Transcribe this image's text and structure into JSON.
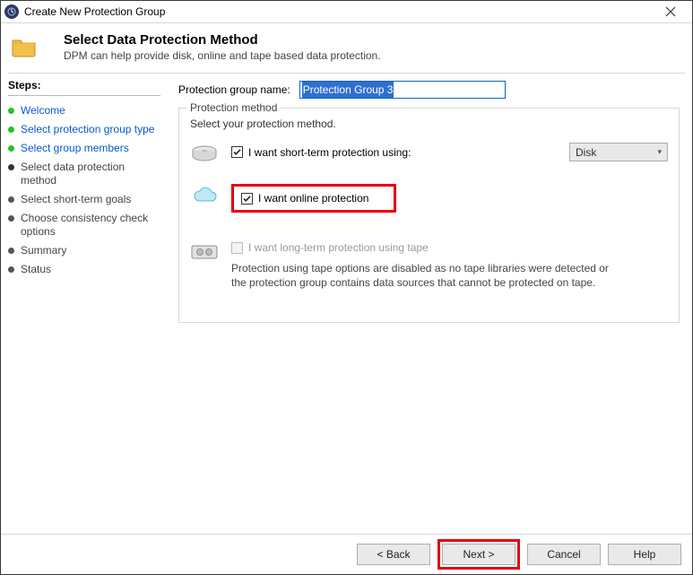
{
  "window": {
    "title": "Create New Protection Group"
  },
  "header": {
    "title": "Select Data Protection Method",
    "subtitle": "DPM can help provide disk, online and tape based data protection."
  },
  "sidebar": {
    "heading": "Steps:",
    "items": [
      {
        "label": "Welcome",
        "state": "done"
      },
      {
        "label": "Select protection group type",
        "state": "done"
      },
      {
        "label": "Select group members",
        "state": "done"
      },
      {
        "label": "Select data protection method",
        "state": "current"
      },
      {
        "label": "Select short-term goals",
        "state": "pending"
      },
      {
        "label": "Choose consistency check options",
        "state": "pending"
      },
      {
        "label": "Summary",
        "state": "pending"
      },
      {
        "label": "Status",
        "state": "pending"
      }
    ]
  },
  "main": {
    "name_label": "Protection group name:",
    "name_value": "Protection Group 3",
    "method_legend": "Protection method",
    "method_instruction": "Select your protection method.",
    "short_term_label": "I want short-term protection using:",
    "short_term_checked": true,
    "short_term_select": "Disk",
    "online_label": "I want online protection",
    "online_checked": true,
    "tape_label": "I want long-term protection using tape",
    "tape_enabled": false,
    "tape_note": "Protection using tape options are disabled as no tape libraries were detected or the protection group contains data sources that cannot be protected on tape."
  },
  "footer": {
    "back": "< Back",
    "next": "Next >",
    "cancel": "Cancel",
    "help": "Help"
  }
}
